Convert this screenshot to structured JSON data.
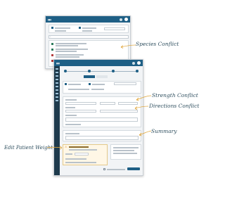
{
  "annotations": {
    "species_conflict": "Species Conflict",
    "strength_conflict": "Strength Conflict",
    "directions_conflict": "Directions Conflict",
    "summary": "Summary",
    "edit_patient_weight": "Edit Patient Weight"
  },
  "colors": {
    "brand_bar": "#1e5f85",
    "sidebar": "#1e3a4c",
    "annotation_ink": "#2f4f5f",
    "arrow_ink": "#e0a63a",
    "warning": "#e08a1e"
  },
  "icons": {
    "avatar": "user-avatar-icon",
    "warning": "warning-icon",
    "nav": "sidebar-nav-icon"
  }
}
